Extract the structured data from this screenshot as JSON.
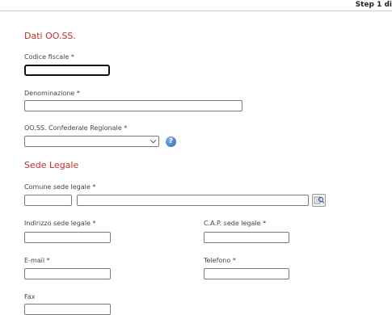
{
  "header": {
    "step_text": "Step 1 di"
  },
  "section1": {
    "title": "Dati OO.SS.",
    "codice_fiscale_label": "Codice fiscale *",
    "denominazione_label": "Denominazione *",
    "oo_ss_label": "OO.SS. Confederale Regionale *",
    "oo_ss_selected": "",
    "help_icon": "help-icon"
  },
  "section2": {
    "title": "Sede Legale",
    "comune_label": "Comune sede legale *",
    "lookup_icon": "lookup-icon",
    "indirizzo_label": "Indirizzo sede legale *",
    "cap_label": "C.A.P. sede legale *",
    "email_label": "E-mail *",
    "telefono_label": "Telefono *",
    "fax_label": "Fax"
  }
}
